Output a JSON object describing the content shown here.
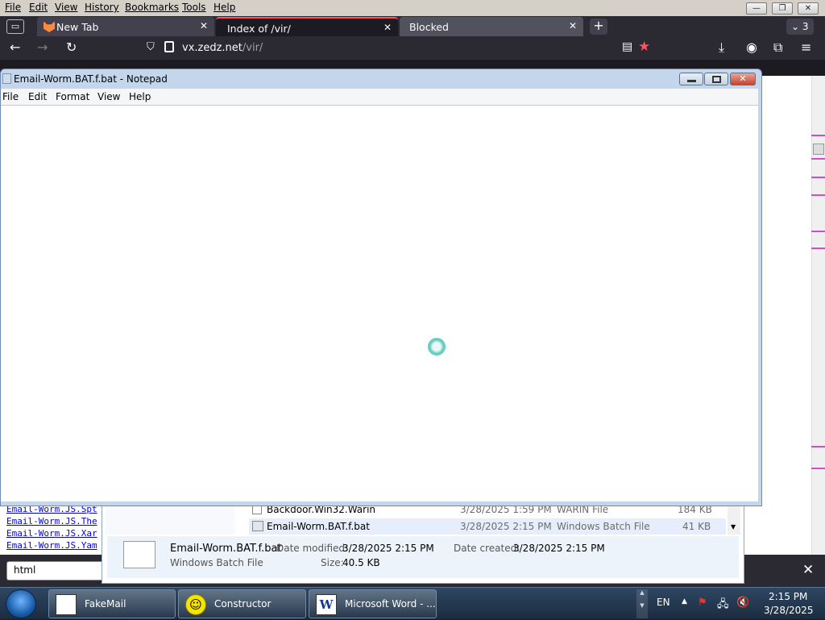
{
  "firefox": {
    "menu": [
      "File",
      "Edit",
      "View",
      "History",
      "Bookmarks",
      "Tools",
      "Help"
    ],
    "tabs": [
      {
        "label": "New Tab"
      },
      {
        "label": "Index of /vir/"
      },
      {
        "label": "Blocked"
      }
    ],
    "tab_count": "3",
    "url": {
      "domain": "vx.zedz.net",
      "path": "/vir/"
    },
    "page_links": [
      "Email-Worm.JS.Spt",
      "Email-Worm.JS.The",
      "Email-Worm.JS.Xar",
      "Email-Worm.JS.Yam"
    ],
    "find_value": "html"
  },
  "notepad": {
    "title": "Email-Worm.BAT.f.bat - Notepad",
    "menu": [
      "File",
      "Edit",
      "Format",
      "View",
      "Help"
    ]
  },
  "explorer": {
    "rows": [
      {
        "name": "Backdoor.Win32.Warin",
        "date": "3/28/2025 1:59 PM",
        "type": "WARIN File",
        "size": "184 KB"
      },
      {
        "name": "Email-Worm.BAT.f.bat",
        "date": "3/28/2025 2:15 PM",
        "type": "Windows Batch File",
        "size": "41 KB"
      }
    ],
    "details": {
      "name": "Email-Worm.BAT.f.bat",
      "type": "Windows Batch File",
      "modified_label": "Date modified:",
      "modified": "3/28/2025 2:15 PM",
      "created_label": "Date created:",
      "created": "3/28/2025 2:15 PM",
      "size_label": "Size:",
      "size": "40.5 KB"
    }
  },
  "taskbar": {
    "items": [
      {
        "label": "FakeMail"
      },
      {
        "label": "Constructor"
      },
      {
        "label": "Microsoft Word - ..."
      }
    ],
    "lang": "EN",
    "time": "2:15 PM",
    "date": "3/28/2025"
  }
}
